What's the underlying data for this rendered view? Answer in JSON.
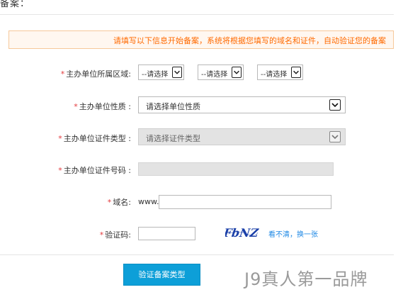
{
  "header": {
    "title": "备案："
  },
  "notice": {
    "text": "请填写以下信息开始备案，系统将根据您填写的域名和证件，自动验证您的备案"
  },
  "form": {
    "required_mark": "*",
    "region": {
      "label": "主办单位所属区域:",
      "province": "--请选择",
      "city": "--请选择",
      "district": "--请选择"
    },
    "org_type": {
      "label": "主办单位性质 :",
      "value": "请选择单位性质"
    },
    "cert_type": {
      "label": "主办单位证件类型 :",
      "value": "请选择证件类型"
    },
    "cert_number": {
      "label": "主办单位证件号码 :",
      "value": ""
    },
    "domain": {
      "label": "域名:",
      "prefix": "www.",
      "value": ""
    },
    "captcha": {
      "label": "验证码:",
      "value": "",
      "image_text": "FbNZ",
      "refresh_label": "看不清，换一张"
    },
    "submit_label": "验证备案类型"
  },
  "watermark": {
    "text": "J9真人第一品牌"
  },
  "colors": {
    "notice_text": "#ff6a00",
    "notice_border": "#f6c89a",
    "required": "#e4393c",
    "link": "#1e88e5",
    "button": "#0d9fd8",
    "captcha": "#1a3fa8"
  }
}
